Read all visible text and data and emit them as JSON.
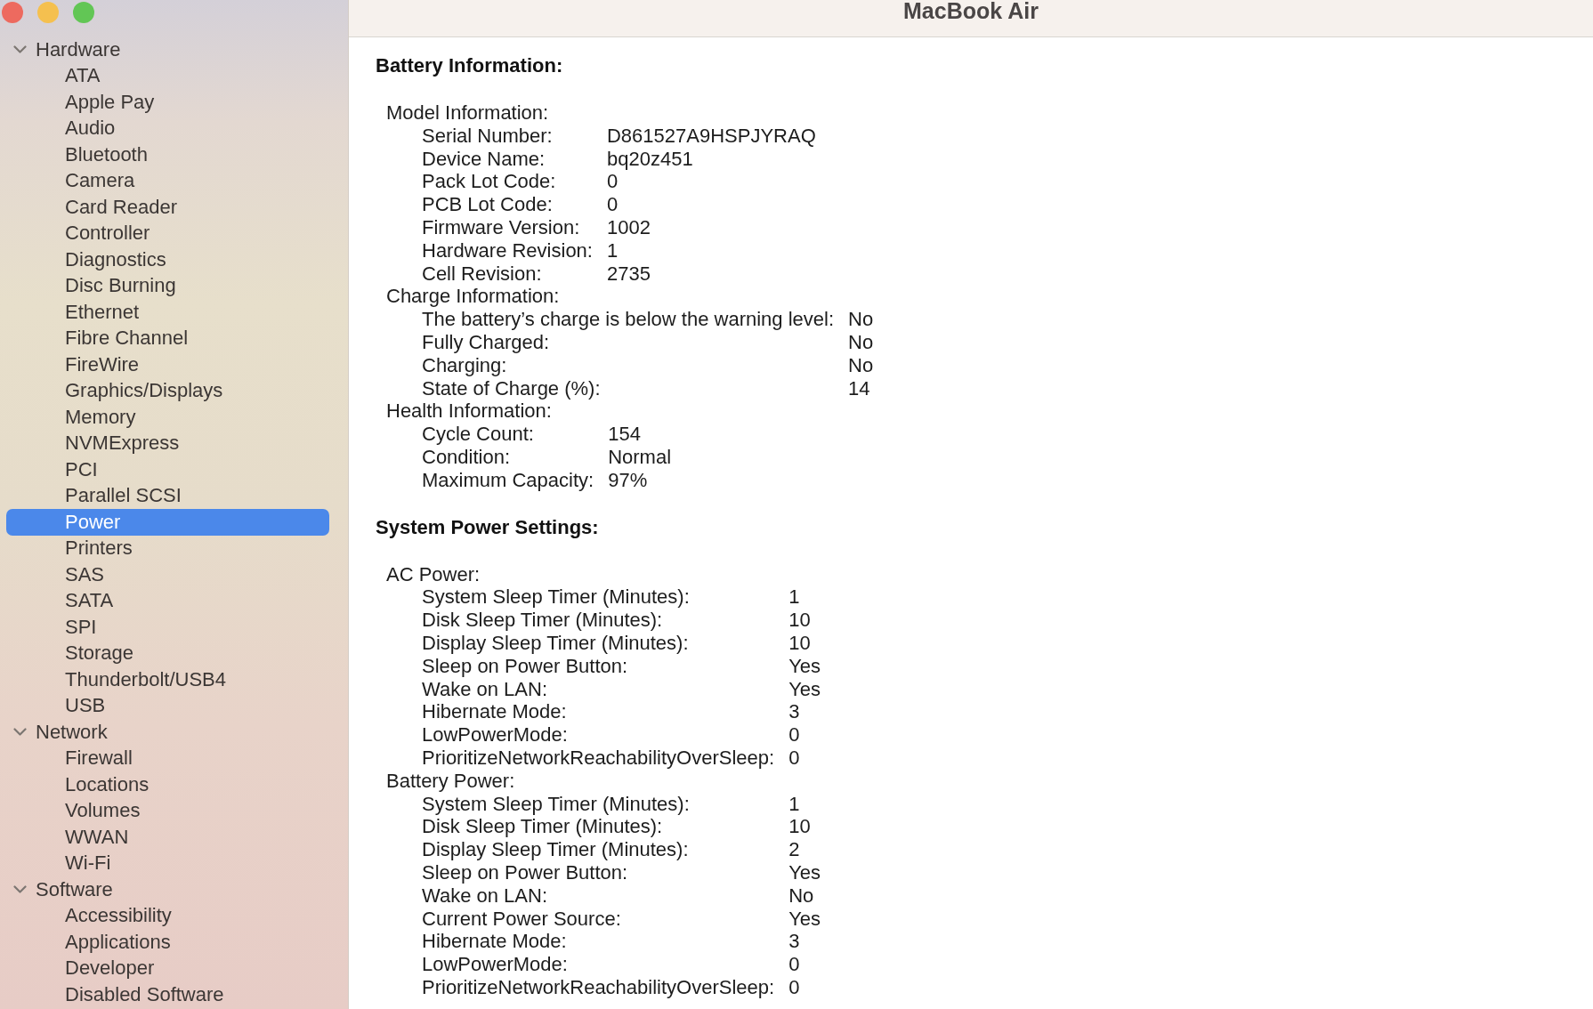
{
  "window": {
    "title": "MacBook Air"
  },
  "sidebar": {
    "groups": [
      {
        "label": "Hardware",
        "expanded": true,
        "children": [
          {
            "label": "ATA",
            "selected": false
          },
          {
            "label": "Apple Pay",
            "selected": false
          },
          {
            "label": "Audio",
            "selected": false
          },
          {
            "label": "Bluetooth",
            "selected": false
          },
          {
            "label": "Camera",
            "selected": false
          },
          {
            "label": "Card Reader",
            "selected": false
          },
          {
            "label": "Controller",
            "selected": false
          },
          {
            "label": "Diagnostics",
            "selected": false
          },
          {
            "label": "Disc Burning",
            "selected": false
          },
          {
            "label": "Ethernet",
            "selected": false
          },
          {
            "label": "Fibre Channel",
            "selected": false
          },
          {
            "label": "FireWire",
            "selected": false
          },
          {
            "label": "Graphics/Displays",
            "selected": false
          },
          {
            "label": "Memory",
            "selected": false
          },
          {
            "label": "NVMExpress",
            "selected": false
          },
          {
            "label": "PCI",
            "selected": false
          },
          {
            "label": "Parallel SCSI",
            "selected": false
          },
          {
            "label": "Power",
            "selected": true
          },
          {
            "label": "Printers",
            "selected": false
          },
          {
            "label": "SAS",
            "selected": false
          },
          {
            "label": "SATA",
            "selected": false
          },
          {
            "label": "SPI",
            "selected": false
          },
          {
            "label": "Storage",
            "selected": false
          },
          {
            "label": "Thunderbolt/USB4",
            "selected": false
          },
          {
            "label": "USB",
            "selected": false
          }
        ]
      },
      {
        "label": "Network",
        "expanded": true,
        "children": [
          {
            "label": "Firewall",
            "selected": false
          },
          {
            "label": "Locations",
            "selected": false
          },
          {
            "label": "Volumes",
            "selected": false
          },
          {
            "label": "WWAN",
            "selected": false
          },
          {
            "label": "Wi-Fi",
            "selected": false
          }
        ]
      },
      {
        "label": "Software",
        "expanded": true,
        "children": [
          {
            "label": "Accessibility",
            "selected": false
          },
          {
            "label": "Applications",
            "selected": false
          },
          {
            "label": "Developer",
            "selected": false
          },
          {
            "label": "Disabled Software",
            "selected": false
          }
        ]
      }
    ]
  },
  "content": {
    "sections": [
      {
        "title": "Battery Information:",
        "children": [
          {
            "label": "Model Information:",
            "children": [
              {
                "label": "Serial Number:",
                "value": "D861527A9HSPJYRAQ"
              },
              {
                "label": "Device Name:",
                "value": "bq20z451"
              },
              {
                "label": "Pack Lot Code:",
                "value": "0"
              },
              {
                "label": "PCB Lot Code:",
                "value": "0"
              },
              {
                "label": "Firmware Version:",
                "value": "1002"
              },
              {
                "label": "Hardware Revision:",
                "value": "1"
              },
              {
                "label": "Cell Revision:",
                "value": "2735"
              }
            ]
          },
          {
            "label": "Charge Information:",
            "children": [
              {
                "label": "The battery’s charge is below the warning level:",
                "value": "No"
              },
              {
                "label": "Fully Charged:",
                "value": "No"
              },
              {
                "label": "Charging:",
                "value": "No"
              },
              {
                "label": "State of Charge (%):",
                "value": "14"
              }
            ]
          },
          {
            "label": "Health Information:",
            "children": [
              {
                "label": "Cycle Count:",
                "value": "154"
              },
              {
                "label": "Condition:",
                "value": "Normal"
              },
              {
                "label": "Maximum Capacity:",
                "value": "97%"
              }
            ]
          }
        ]
      },
      {
        "title": "System Power Settings:",
        "children": [
          {
            "label": "AC Power:",
            "children": [
              {
                "label": "System Sleep Timer (Minutes):",
                "value": "1"
              },
              {
                "label": "Disk Sleep Timer (Minutes):",
                "value": "10"
              },
              {
                "label": "Display Sleep Timer (Minutes):",
                "value": "10"
              },
              {
                "label": "Sleep on Power Button:",
                "value": "Yes"
              },
              {
                "label": "Wake on LAN:",
                "value": "Yes"
              },
              {
                "label": "Hibernate Mode:",
                "value": "3"
              },
              {
                "label": "LowPowerMode:",
                "value": "0"
              },
              {
                "label": "PrioritizeNetworkReachabilityOverSleep:",
                "value": "0"
              }
            ]
          },
          {
            "label": "Battery Power:",
            "children": [
              {
                "label": "System Sleep Timer (Minutes):",
                "value": "1"
              },
              {
                "label": "Disk Sleep Timer (Minutes):",
                "value": "10"
              },
              {
                "label": "Display Sleep Timer (Minutes):",
                "value": "2"
              },
              {
                "label": "Sleep on Power Button:",
                "value": "Yes"
              },
              {
                "label": "Wake on LAN:",
                "value": "No"
              },
              {
                "label": "Current Power Source:",
                "value": "Yes"
              },
              {
                "label": "Hibernate Mode:",
                "value": "3"
              },
              {
                "label": "LowPowerMode:",
                "value": "0"
              },
              {
                "label": "PrioritizeNetworkReachabilityOverSleep:",
                "value": "0"
              }
            ]
          }
        ]
      }
    ]
  }
}
